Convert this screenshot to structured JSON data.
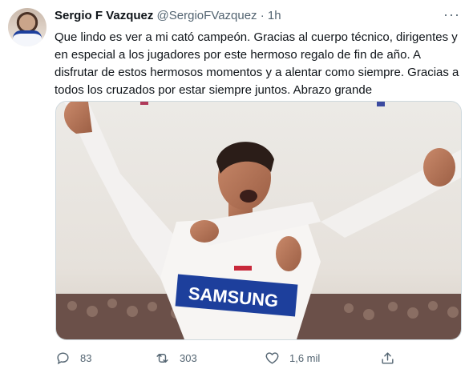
{
  "tweet": {
    "author_name": "Sergio F Vazquez",
    "handle": "@SergioFVazquez",
    "separator": "·",
    "time": "1h",
    "more_icon": "more-horizontal-icon",
    "text": "Que lindo es ver a mi cató campeón. Gracias al cuerpo técnico, dirigentes y en especial a los jugadores por este hermoso regalo de fin de año. A disfrutar de estos hermosos momentos y a alentar como siempre. Gracias a todos los cruzados por estar siempre juntos. Abrazo grande",
    "photo": {
      "shirt_sponsor": "SAMSUNG"
    }
  },
  "actions": {
    "reply": {
      "icon": "reply-icon",
      "count": "83"
    },
    "retweet": {
      "icon": "retweet-icon",
      "count": "303"
    },
    "like": {
      "icon": "heart-icon",
      "count": "1,6 mil"
    },
    "share": {
      "icon": "share-icon"
    }
  },
  "colors": {
    "text": "#0f1419",
    "secondary": "#536471",
    "border": "#cfd9de",
    "jersey_band": "#1d3f9c"
  }
}
